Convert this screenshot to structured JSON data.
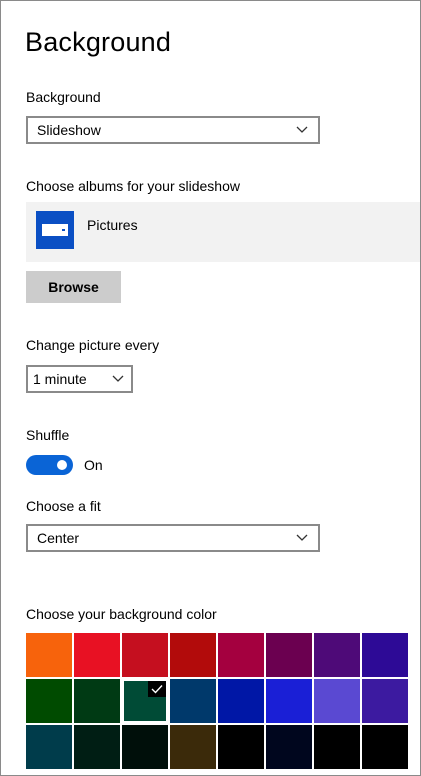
{
  "page": {
    "title": "Background"
  },
  "background": {
    "label": "Background",
    "selected": "Slideshow"
  },
  "albums": {
    "label": "Choose albums for your slideshow",
    "items": [
      {
        "name": "Pictures",
        "icon": "folder-icon"
      }
    ],
    "browse_label": "Browse"
  },
  "interval": {
    "label": "Change picture every",
    "selected": "1 minute"
  },
  "shuffle": {
    "label": "Shuffle",
    "state_label": "On",
    "on": true
  },
  "fit": {
    "label": "Choose a fit",
    "selected": "Center"
  },
  "color": {
    "label": "Choose your background color",
    "accent": "#0a64d6",
    "selected_index": 10,
    "swatches": [
      "#f7630c",
      "#e81123",
      "#c50f1f",
      "#b20b0b",
      "#a4003f",
      "#6b0050",
      "#4e0a78",
      "#2d0a96",
      "#004b00",
      "#003a14",
      "#004b36",
      "#00396b",
      "#0017a6",
      "#1a1fd6",
      "#5a49d2",
      "#3c1aa0",
      "#003c4b",
      "#001e14",
      "#000f0a",
      "#3b2a0a",
      "#000000",
      "#00061e",
      "#000000",
      "#000000"
    ]
  }
}
